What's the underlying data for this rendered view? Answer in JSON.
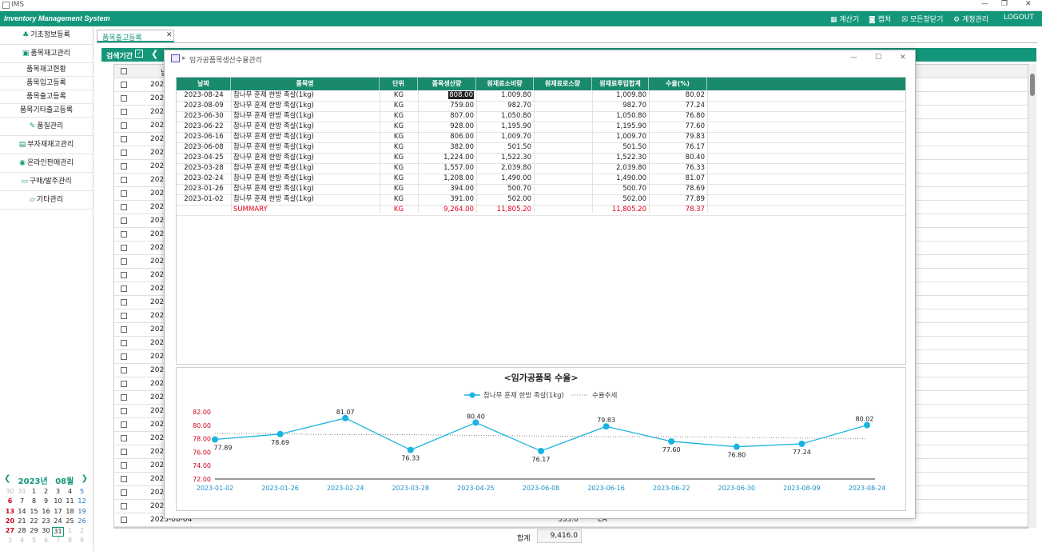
{
  "window": {
    "title": "IMS"
  },
  "topbar": {
    "app_name": "Inventory Management System",
    "buttons": [
      {
        "label": "계산기",
        "icon": "calculator-icon"
      },
      {
        "label": "캡처",
        "icon": "camera-icon"
      },
      {
        "label": "모든창닫기",
        "icon": "close-all-icon"
      },
      {
        "label": "계정관리",
        "icon": "gear-icon"
      },
      {
        "label": "LOGOUT",
        "icon": ""
      }
    ]
  },
  "sidebar": {
    "menu": [
      {
        "label": "기초정보등록",
        "type": "major"
      },
      {
        "label": "품목재고관리",
        "type": "major"
      },
      {
        "label": "품목재고현황",
        "type": "minor"
      },
      {
        "label": "품목입고등록",
        "type": "minor"
      },
      {
        "label": "품목출고등록",
        "type": "minor"
      },
      {
        "label": "품목기타출고등록",
        "type": "minor"
      },
      {
        "label": "품질관리",
        "type": "major"
      },
      {
        "label": "부자재재고관리",
        "type": "major"
      },
      {
        "label": "온라인판매관리",
        "type": "major"
      },
      {
        "label": "구매/발주관리",
        "type": "major"
      },
      {
        "label": "기타관리",
        "type": "major"
      }
    ]
  },
  "calendar": {
    "year_label": "2023년",
    "month_label": "08월",
    "weeks": [
      [
        "30",
        "31",
        "1",
        "2",
        "3",
        "4",
        "5"
      ],
      [
        "6",
        "7",
        "8",
        "9",
        "10",
        "11",
        "12"
      ],
      [
        "13",
        "14",
        "15",
        "16",
        "17",
        "18",
        "19"
      ],
      [
        "20",
        "21",
        "22",
        "23",
        "24",
        "25",
        "26"
      ],
      [
        "27",
        "28",
        "29",
        "30",
        "31",
        "1",
        "2"
      ],
      [
        "3",
        "4",
        "5",
        "6",
        "7",
        "8",
        "9"
      ]
    ],
    "selected": "31"
  },
  "tab": {
    "label": "품목출고등록"
  },
  "search": {
    "label": "검색기간"
  },
  "bg_table": {
    "row_year": "2023",
    "header_partial": "날",
    "partial_row": "2023-08-04",
    "footer_label": "합계",
    "footer_value": "9,416.0",
    "partial_value": "535.0",
    "partial_unit": "EA"
  },
  "modal": {
    "title": "임가공품목생산수율관리",
    "columns": [
      "날짜",
      "품목명",
      "단위",
      "품목생산량",
      "원재료소비량",
      "원재료로스량",
      "원재료투입합계",
      "수율(%)"
    ],
    "rows": [
      [
        "2023-08-24",
        "참나무 훈제 한방 족살(1kg)",
        "KG",
        "808.00",
        "1,009.80",
        "",
        "1,009.80",
        "80.02"
      ],
      [
        "2023-08-09",
        "참나무 훈제 한방 족살(1kg)",
        "KG",
        "759.00",
        "982.70",
        "",
        "982.70",
        "77.24"
      ],
      [
        "2023-06-30",
        "참나무 훈제 한방 족살(1kg)",
        "KG",
        "807.00",
        "1,050.80",
        "",
        "1,050.80",
        "76.80"
      ],
      [
        "2023-06-22",
        "참나무 훈제 한방 족살(1kg)",
        "KG",
        "928.00",
        "1,195.90",
        "",
        "1,195.90",
        "77.60"
      ],
      [
        "2023-06-16",
        "참나무 훈제 한방 족살(1kg)",
        "KG",
        "806.00",
        "1,009.70",
        "",
        "1,009.70",
        "79.83"
      ],
      [
        "2023-06-08",
        "참나무 훈제 한방 족살(1kg)",
        "KG",
        "382.00",
        "501.50",
        "",
        "501.50",
        "76.17"
      ],
      [
        "2023-04-25",
        "참나무 훈제 한방 족살(1kg)",
        "KG",
        "1,224.00",
        "1,522.30",
        "",
        "1,522.30",
        "80.40"
      ],
      [
        "2023-03-28",
        "참나무 훈제 한방 족살(1kg)",
        "KG",
        "1,557.00",
        "2,039.80",
        "",
        "2,039.80",
        "76.33"
      ],
      [
        "2023-02-24",
        "참나무 훈제 한방 족살(1kg)",
        "KG",
        "1,208.00",
        "1,490.00",
        "",
        "1,490.00",
        "81.07"
      ],
      [
        "2023-01-26",
        "참나무 훈제 한방 족살(1kg)",
        "KG",
        "394.00",
        "500.70",
        "",
        "500.70",
        "78.69"
      ],
      [
        "2023-01-02",
        "참나무 훈제 한방 족살(1kg)",
        "KG",
        "391.00",
        "502.00",
        "",
        "502.00",
        "77.89"
      ]
    ],
    "summary": [
      "",
      "SUMMARY",
      "KG",
      "9,264.00",
      "11,805.20",
      "",
      "11,805.20",
      "78.37"
    ]
  },
  "chart_data": {
    "type": "line",
    "title": "<임가공품목 수율>",
    "categories": [
      "2023-01-02",
      "2023-01-26",
      "2023-02-24",
      "2023-03-28",
      "2023-04-25",
      "2023-06-08",
      "2023-06-16",
      "2023-06-22",
      "2023-06-30",
      "2023-08-09",
      "2023-08-24"
    ],
    "series": [
      {
        "name": "참나무 훈제 한방 족살(1kg)",
        "values": [
          77.89,
          78.69,
          81.07,
          76.33,
          80.4,
          76.17,
          79.83,
          77.6,
          76.8,
          77.24,
          80.02
        ],
        "color": "#1ab3e0"
      },
      {
        "name": "수율추세",
        "values": [
          78.8,
          78.7,
          78.6,
          78.6,
          78.5,
          78.4,
          78.3,
          78.3,
          78.2,
          78.1,
          78.0
        ],
        "color": "#888888",
        "style": "dotted"
      }
    ],
    "yticks": [
      "72.00",
      "74.00",
      "76.00",
      "78.00",
      "80.00",
      "82.00"
    ],
    "ylim": [
      72,
      82
    ],
    "legend": "top-center",
    "grid": false
  },
  "colors": {
    "accent": "#14967a",
    "header": "#1a8a6c",
    "summary_red": "#e0001a",
    "line": "#1ab3e0"
  }
}
